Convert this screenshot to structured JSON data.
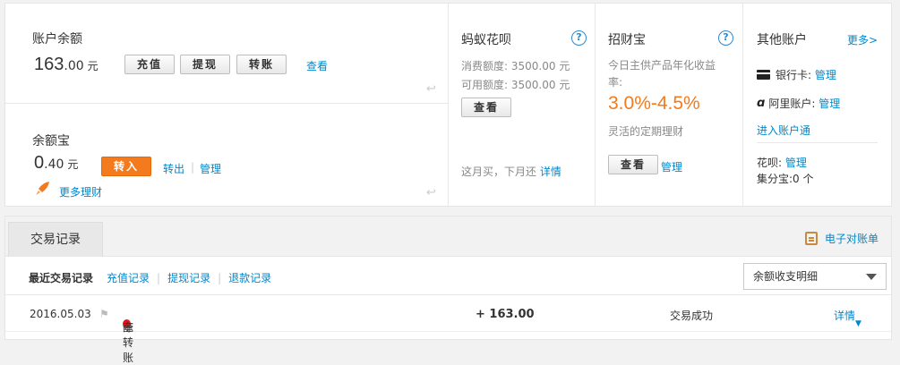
{
  "balance": {
    "label": "账户余额",
    "int": "163",
    "dec": ".00",
    "unit": "元",
    "btn_recharge": "充值",
    "btn_withdraw": "提现",
    "btn_transfer": "转账",
    "view_link": "查看"
  },
  "yuebao": {
    "label": "余额宝",
    "int": "0",
    "dec": ".40",
    "unit": "元",
    "btn_in": "转入",
    "link_out": "转出",
    "link_manage": "管理",
    "more_label": "更多理财"
  },
  "huabei": {
    "title": "蚂蚁花呗",
    "limit_label": "消费额度:",
    "limit_value": "3500.00 元",
    "avail_label": "可用额度:",
    "avail_value": "3500.00 元",
    "btn_view": "查看",
    "slogan": "这月买，下月还",
    "detail_link": "详情"
  },
  "zhaocaibao": {
    "title": "招财宝",
    "desc_line1": "今日主供产品年化收益",
    "desc_line2": "率:",
    "rate": "3.0%-4.5%",
    "sub": "灵活的定期理财",
    "btn_view": "查看",
    "manage_link": "管理"
  },
  "other": {
    "title": "其他账户",
    "more": "更多>",
    "bank_label": "银行卡:",
    "bank_manage": "管理",
    "ali_label": "阿里账户:",
    "ali_manage": "管理",
    "enter_link": "进入账户通",
    "huabei_label": "花呗:",
    "huabei_manage": "管理",
    "jifen_label": "集分宝:",
    "jifen_value": "0 个"
  },
  "trade": {
    "tab_label": "交易记录",
    "ebill": "电子对账单",
    "recent": "最近交易记录",
    "links": [
      "充值记录",
      "提现记录",
      "退款记录"
    ],
    "select_value": "余额收支明细",
    "rows": [
      {
        "date": "2016.05.03",
        "name_prefix": "陈",
        "name_suffix": "奎转账",
        "amount": "+ 163.00",
        "status": "交易成功",
        "detail": "详情"
      }
    ]
  },
  "colors": {
    "accent_orange": "#f37b1d",
    "link_blue": "#0088cc"
  }
}
